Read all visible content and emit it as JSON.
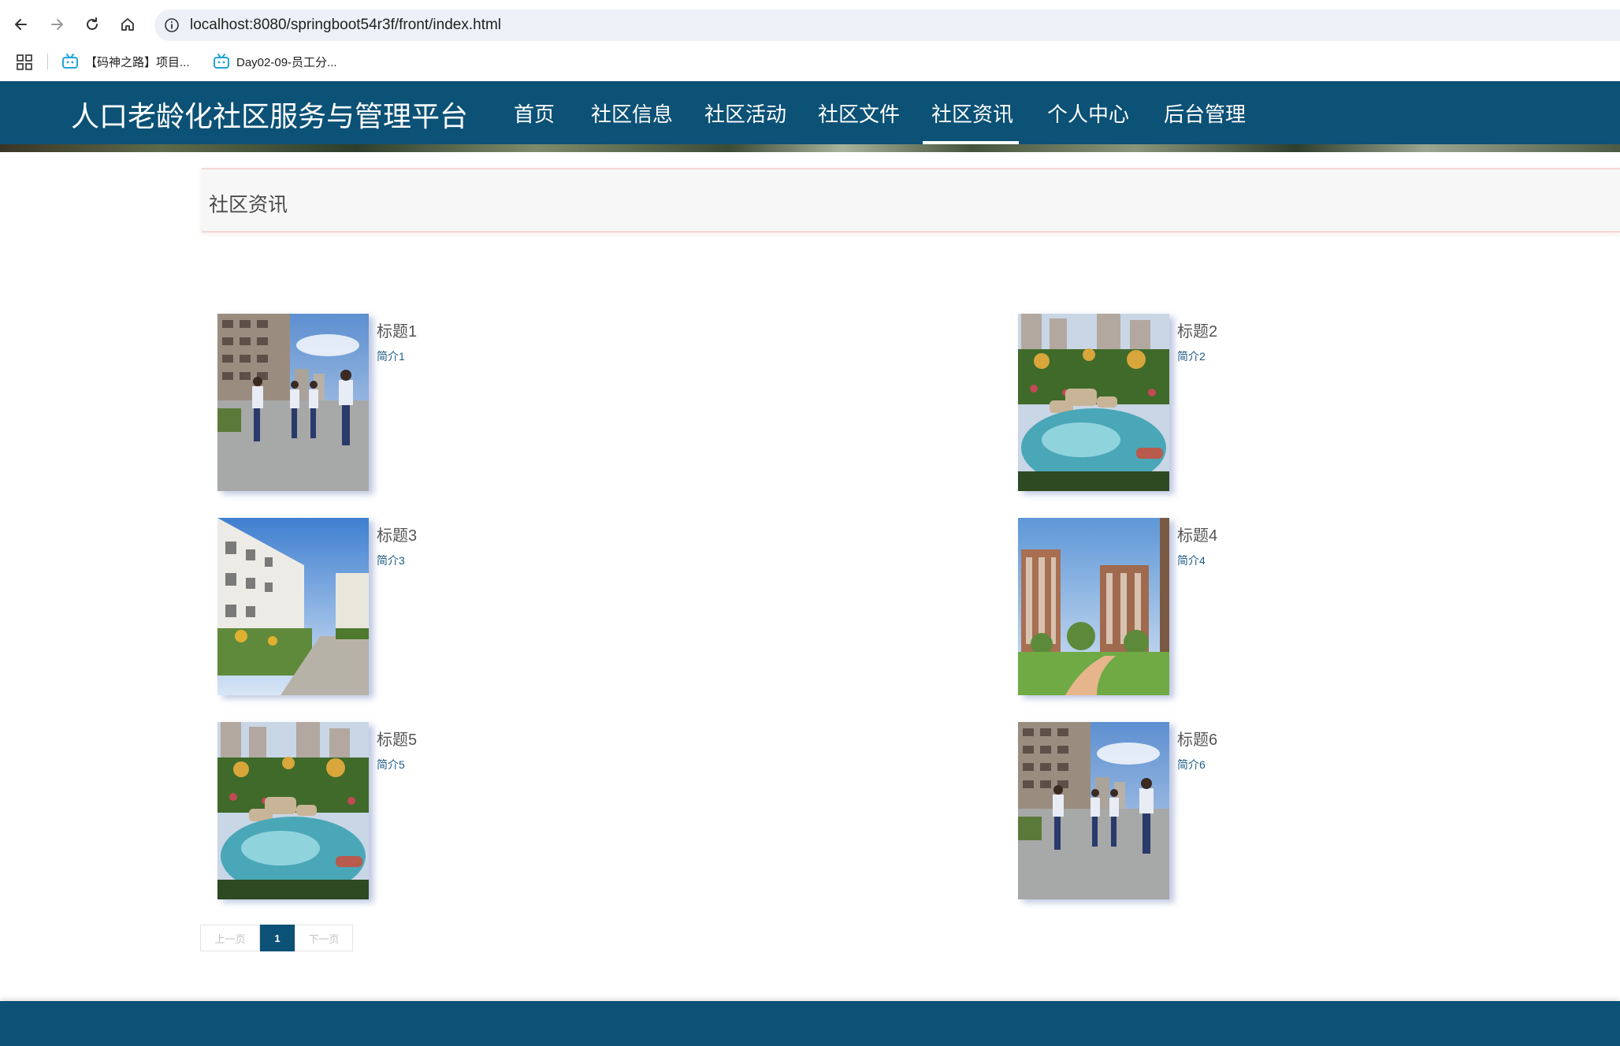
{
  "browser": {
    "url": "localhost:8080/springboot54r3f/front/index.html",
    "bookmarks": [
      {
        "label": "【码神之路】项目..."
      },
      {
        "label": "Day02-09-员工分..."
      }
    ]
  },
  "site": {
    "brand": "人口老龄化社区服务与管理平台",
    "nav": [
      {
        "label": "首页"
      },
      {
        "label": "社区信息"
      },
      {
        "label": "社区活动"
      },
      {
        "label": "社区文件"
      },
      {
        "label": "社区资讯",
        "active": true
      },
      {
        "label": "个人中心"
      },
      {
        "label": "后台管理"
      }
    ],
    "accent_color": "#0c5176"
  },
  "section": {
    "title": "社区资讯"
  },
  "news": [
    {
      "title": "标题1",
      "summary": "简介1",
      "image": "people-walking-photo"
    },
    {
      "title": "标题2",
      "summary": "简介2",
      "image": "garden-pond-photo"
    },
    {
      "title": "标题3",
      "summary": "简介3",
      "image": "residential-street-photo"
    },
    {
      "title": "标题4",
      "summary": "简介4",
      "image": "tower-garden-photo"
    },
    {
      "title": "标题5",
      "summary": "简介5",
      "image": "garden-pond-photo"
    },
    {
      "title": "标题6",
      "summary": "简介6",
      "image": "people-walking-photo"
    }
  ],
  "pagination": {
    "prev": "上一页",
    "current": "1",
    "next": "下一页"
  }
}
